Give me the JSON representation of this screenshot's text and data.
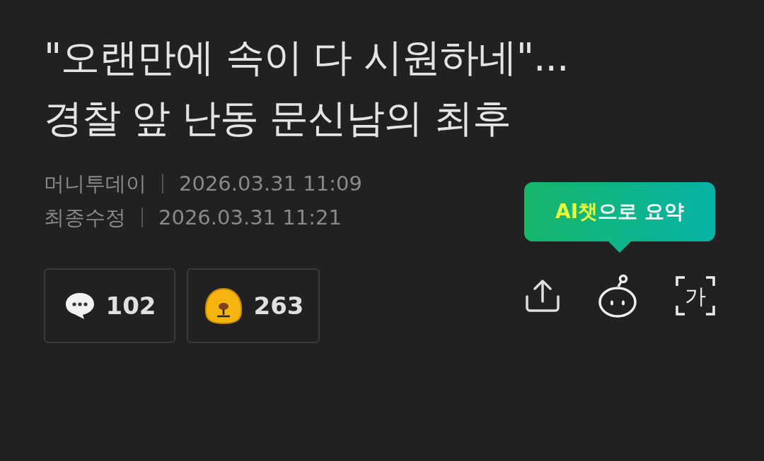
{
  "headline": [
    "\"오랜만에 속이 다 시원하네\"...",
    "경찰 앞 난동 문신남의 최후"
  ],
  "meta": [
    {
      "label": "머니투데이",
      "value": "2026.03.31 11:09"
    },
    {
      "label": "최종수정",
      "value": "2026.03.31 11:21"
    }
  ],
  "counters": [
    {
      "kind": "comment",
      "count": "102"
    },
    {
      "kind": "reaction",
      "count": "263"
    }
  ],
  "ai_tooltip": {
    "highlight": "AI챗",
    "text": "으로 요약"
  },
  "toolbar": [
    {
      "kind": "share"
    },
    {
      "kind": "bot"
    },
    {
      "kind": "font",
      "glyph": "가"
    }
  ]
}
